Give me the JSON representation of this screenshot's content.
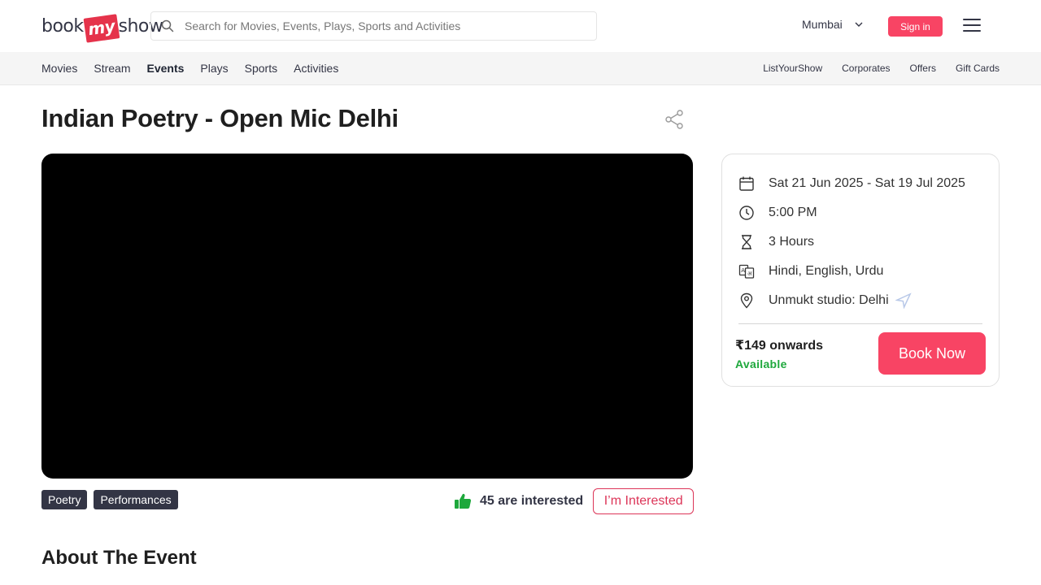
{
  "header": {
    "logo": {
      "left": "book",
      "mid": "my",
      "right": "show"
    },
    "search_placeholder": "Search for Movies, Events, Plays, Sports and Activities",
    "city": "Mumbai",
    "signin_label": "Sign in"
  },
  "subnav": {
    "left": [
      "Movies",
      "Stream",
      "Events",
      "Plays",
      "Sports",
      "Activities"
    ],
    "right": [
      "ListYourShow",
      "Corporates",
      "Offers",
      "Gift Cards"
    ]
  },
  "event": {
    "title": "Indian Poetry - Open Mic Delhi",
    "tags": [
      "Poetry",
      "Performances"
    ],
    "interested_count": "45 are interested",
    "interested_button": "I’m Interested"
  },
  "card": {
    "dates": "Sat 21 Jun 2025 - Sat 19 Jul 2025",
    "time": "5:00 PM",
    "duration": "3 Hours",
    "languages": "Hindi, English, Urdu",
    "venue": "Unmukt studio: Delhi",
    "price": "₹149 onwards",
    "availability": "Available",
    "book_label": "Book Now"
  },
  "about_heading": "About The Event",
  "colors": {
    "brand": "#f84464",
    "dark": "#333545",
    "available": "#1ea83c"
  }
}
